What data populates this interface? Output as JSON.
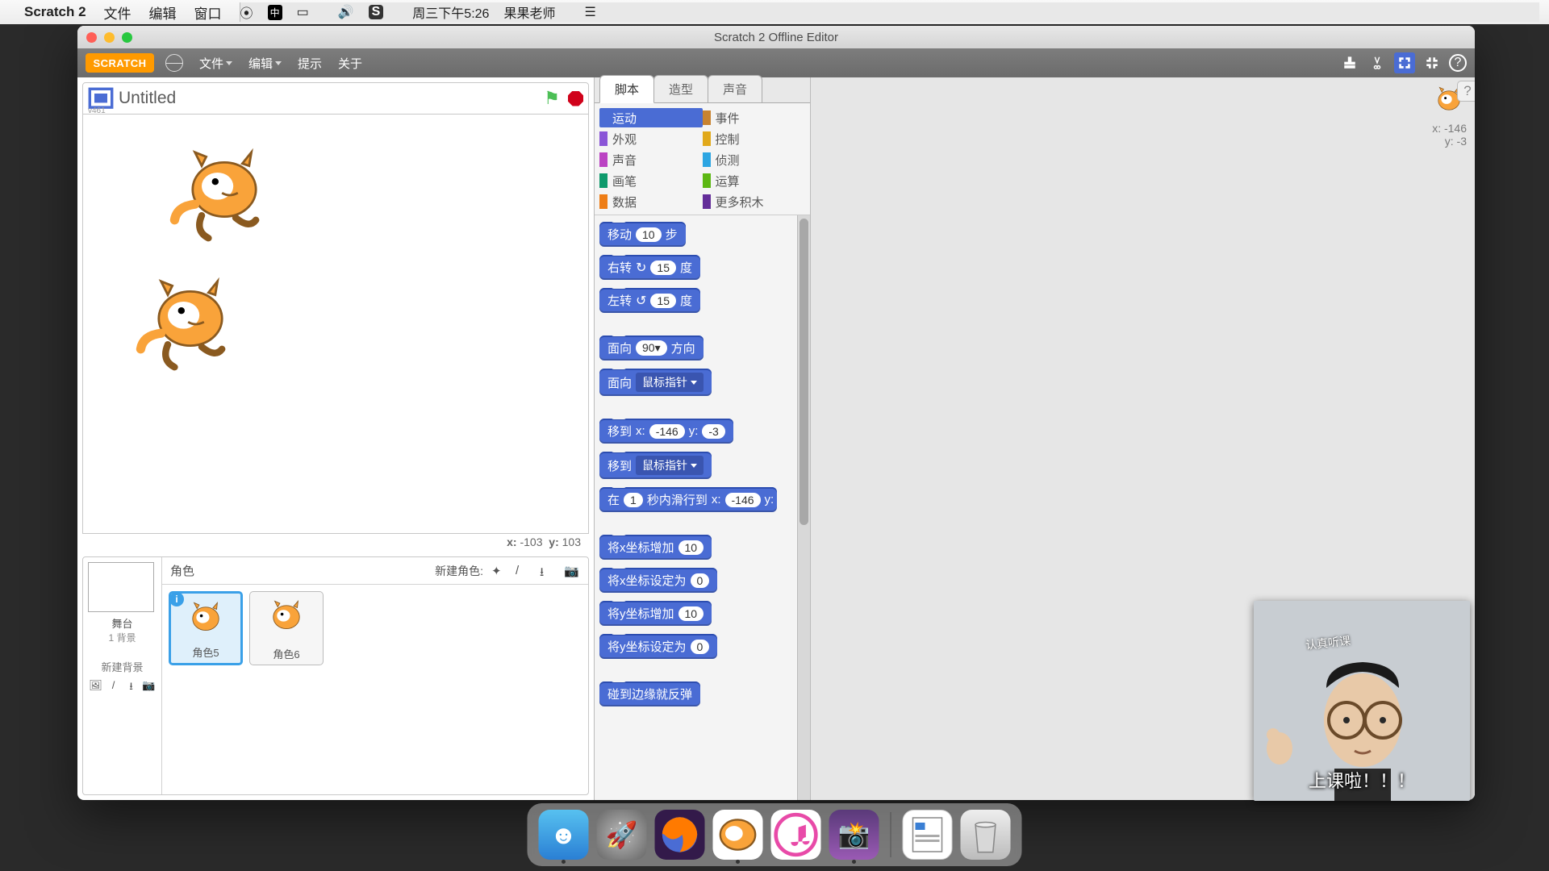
{
  "menubar": {
    "app": "Scratch 2",
    "items": [
      "文件",
      "编辑",
      "窗口"
    ],
    "clock": "周三下午5:26",
    "user": "果果老师"
  },
  "window": {
    "title": "Scratch 2 Offline Editor"
  },
  "scratch_menu": {
    "logo": "SCRATCH",
    "items": [
      "文件",
      "编辑",
      "提示",
      "关于"
    ]
  },
  "project": {
    "name": "Untitled",
    "version": "v461"
  },
  "stage": {
    "mouse_x_label": "x:",
    "mouse_x": "-103",
    "mouse_y_label": "y:",
    "mouse_y": "103"
  },
  "sprite_panel": {
    "sprites_label": "角色",
    "new_sprite_label": "新建角色:",
    "stage_label": "舞台",
    "backdrop_count": "1 背景",
    "new_backdrop_label": "新建背景",
    "sprites": [
      {
        "name": "角色5",
        "selected": true
      },
      {
        "name": "角色6",
        "selected": false
      }
    ]
  },
  "tabs": [
    "脚本",
    "造型",
    "声音"
  ],
  "categories": [
    {
      "name": "运动",
      "color": "#4a6cd4",
      "selected": true
    },
    {
      "name": "事件",
      "color": "#c88330"
    },
    {
      "name": "外观",
      "color": "#8a55d7"
    },
    {
      "name": "控制",
      "color": "#e1a91a"
    },
    {
      "name": "声音",
      "color": "#bb42c3"
    },
    {
      "name": "侦测",
      "color": "#2ca5e2"
    },
    {
      "name": "画笔",
      "color": "#0e9a6c"
    },
    {
      "name": "运算",
      "color": "#5cb712"
    },
    {
      "name": "数据",
      "color": "#ee7d16"
    },
    {
      "name": "更多积木",
      "color": "#632d99"
    }
  ],
  "blocks": {
    "move": {
      "pre": "移动",
      "val": "10",
      "post": "步"
    },
    "turn_r": {
      "pre": "右转",
      "val": "15",
      "post": "度"
    },
    "turn_l": {
      "pre": "左转",
      "val": "15",
      "post": "度"
    },
    "point_dir": {
      "pre": "面向",
      "val": "90▾",
      "post": "方向"
    },
    "point_to": {
      "pre": "面向",
      "drop": "鼠标指针"
    },
    "goto_xy": {
      "pre": "移到",
      "xlab": "x:",
      "x": "-146",
      "ylab": "y:",
      "y": "-3"
    },
    "goto": {
      "pre": "移到",
      "drop": "鼠标指针"
    },
    "glide": {
      "pre": "在",
      "secs": "1",
      "label": "秒内滑行到",
      "xlab": "x:",
      "x": "-146",
      "ylab": "y:"
    },
    "changex": {
      "pre": "将x坐标增加",
      "val": "10"
    },
    "setx": {
      "pre": "将x坐标设定为",
      "val": "0"
    },
    "changey": {
      "pre": "将y坐标增加",
      "val": "10"
    },
    "sety": {
      "pre": "将y坐标设定为",
      "val": "0"
    },
    "bounce": {
      "label": "碰到边缘就反弹"
    }
  },
  "script_info": {
    "xlabel": "x:",
    "x": "-146",
    "ylabel": "y:",
    "y": "-3"
  },
  "webcam": {
    "caption": "上课啦！！！",
    "hat": "认真听课",
    "watermark": ""
  },
  "dock": [
    "Finder",
    "Launchpad",
    "Firefox",
    "Scratch",
    "Music",
    "Screenshot",
    "Doc",
    "Trash"
  ]
}
